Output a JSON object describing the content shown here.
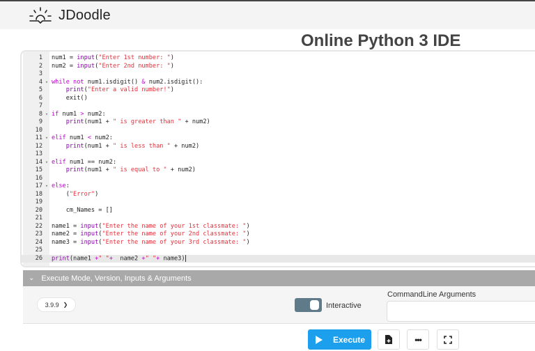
{
  "header": {
    "logo_text": "JDoodle"
  },
  "page_title": "Online Python 3 IDE",
  "editor": {
    "active_line": 26,
    "lines": [
      {
        "n": "1",
        "fold": false,
        "segs": [
          [
            "t",
            "num1 = "
          ],
          [
            "fn",
            "input"
          ],
          [
            "t",
            "("
          ],
          [
            "str",
            "\"Enter 1st number: \""
          ],
          [
            "t",
            ")"
          ]
        ]
      },
      {
        "n": "2",
        "fold": false,
        "segs": [
          [
            "t",
            "num2 = "
          ],
          [
            "fn",
            "input"
          ],
          [
            "t",
            "("
          ],
          [
            "str",
            "\"Enter 2nd number: \""
          ],
          [
            "t",
            ")"
          ]
        ]
      },
      {
        "n": "3",
        "fold": false,
        "segs": []
      },
      {
        "n": "4",
        "fold": true,
        "segs": [
          [
            "kw",
            "while not"
          ],
          [
            "t",
            " num1.isdigit() "
          ],
          [
            "op",
            "&"
          ],
          [
            "t",
            " num2.isdigit():"
          ]
        ]
      },
      {
        "n": "5",
        "fold": false,
        "segs": [
          [
            "t",
            "    "
          ],
          [
            "fn",
            "print"
          ],
          [
            "t",
            "("
          ],
          [
            "str",
            "\"Enter a valid number!\""
          ],
          [
            "t",
            ")"
          ]
        ]
      },
      {
        "n": "6",
        "fold": false,
        "segs": [
          [
            "t",
            "    exit()"
          ]
        ]
      },
      {
        "n": "7",
        "fold": false,
        "segs": []
      },
      {
        "n": "8",
        "fold": true,
        "segs": [
          [
            "kw",
            "if"
          ],
          [
            "t",
            " num1 "
          ],
          [
            "op",
            ">"
          ],
          [
            "t",
            " num2:"
          ]
        ]
      },
      {
        "n": "9",
        "fold": false,
        "segs": [
          [
            "t",
            "    "
          ],
          [
            "fn",
            "print"
          ],
          [
            "t",
            "(num1 + "
          ],
          [
            "str",
            "\" is greater than \""
          ],
          [
            "t",
            " + num2)"
          ]
        ]
      },
      {
        "n": "10",
        "fold": false,
        "segs": []
      },
      {
        "n": "11",
        "fold": true,
        "segs": [
          [
            "kw",
            "elif"
          ],
          [
            "t",
            " num1 "
          ],
          [
            "op",
            "<"
          ],
          [
            "t",
            " num2:"
          ]
        ]
      },
      {
        "n": "12",
        "fold": false,
        "segs": [
          [
            "t",
            "    "
          ],
          [
            "fn",
            "print"
          ],
          [
            "t",
            "(num1 + "
          ],
          [
            "str",
            "\" is less than \""
          ],
          [
            "t",
            " + num2)"
          ]
        ]
      },
      {
        "n": "13",
        "fold": false,
        "segs": []
      },
      {
        "n": "14",
        "fold": true,
        "segs": [
          [
            "kw",
            "elif"
          ],
          [
            "t",
            " num1 == num2:"
          ]
        ]
      },
      {
        "n": "15",
        "fold": false,
        "segs": [
          [
            "t",
            "    "
          ],
          [
            "fn",
            "print"
          ],
          [
            "t",
            "(num1 + "
          ],
          [
            "str",
            "\" is equal to \""
          ],
          [
            "t",
            " + num2)"
          ]
        ]
      },
      {
        "n": "16",
        "fold": false,
        "segs": []
      },
      {
        "n": "17",
        "fold": true,
        "segs": [
          [
            "kw",
            "else"
          ],
          [
            "t",
            ":"
          ]
        ]
      },
      {
        "n": "18",
        "fold": false,
        "segs": [
          [
            "t",
            "    ("
          ],
          [
            "str",
            "\"Error\""
          ],
          [
            "t",
            ")"
          ]
        ]
      },
      {
        "n": "19",
        "fold": false,
        "segs": []
      },
      {
        "n": "20",
        "fold": false,
        "segs": [
          [
            "t",
            "    cm_Names = []"
          ]
        ]
      },
      {
        "n": "21",
        "fold": false,
        "segs": []
      },
      {
        "n": "22",
        "fold": false,
        "segs": [
          [
            "t",
            "name1 = "
          ],
          [
            "fn",
            "input"
          ],
          [
            "t",
            "("
          ],
          [
            "str",
            "\"Enter the name of your 1st classmate: \""
          ],
          [
            "t",
            ")"
          ]
        ]
      },
      {
        "n": "23",
        "fold": false,
        "segs": [
          [
            "t",
            "name2 = "
          ],
          [
            "fn",
            "input"
          ],
          [
            "t",
            "("
          ],
          [
            "str",
            "\"Enter the name of your 2nd classmate: \""
          ],
          [
            "t",
            ")"
          ]
        ]
      },
      {
        "n": "24",
        "fold": false,
        "segs": [
          [
            "t",
            "name3 = "
          ],
          [
            "fn",
            "input"
          ],
          [
            "t",
            "("
          ],
          [
            "str",
            "\"Enter the name of your 3rd classmate: \""
          ],
          [
            "t",
            ")"
          ]
        ]
      },
      {
        "n": "25",
        "fold": false,
        "segs": []
      },
      {
        "n": "26",
        "fold": false,
        "segs": [
          [
            "fn",
            "print"
          ],
          [
            "t",
            "(name1 "
          ],
          [
            "op",
            "+"
          ],
          [
            "str",
            "\" \""
          ],
          [
            "op",
            "+"
          ],
          [
            "t",
            "  name2 "
          ],
          [
            "op",
            "+"
          ],
          [
            "str",
            "\" \""
          ],
          [
            "op",
            "+"
          ],
          [
            "t",
            " name3)"
          ]
        ]
      }
    ]
  },
  "execute_bar": {
    "label": "Execute Mode, Version, Inputs & Arguments"
  },
  "options": {
    "version": "3.9.9",
    "interactive_label": "Interactive",
    "interactive_on": true,
    "cmdline_label": "CommandLine Arguments",
    "cmdline_value": ""
  },
  "actions": {
    "execute_label": "Execute"
  }
}
